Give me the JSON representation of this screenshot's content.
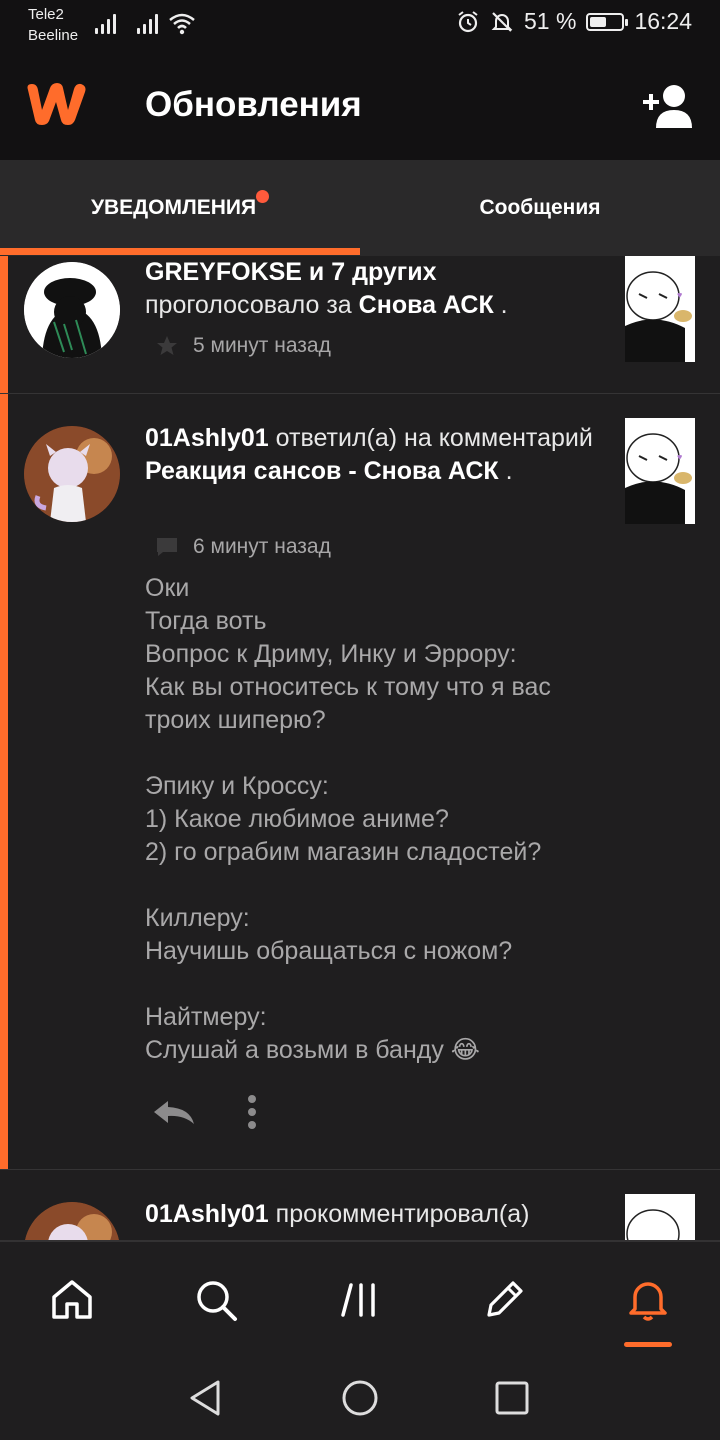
{
  "status_bar": {
    "carrier_1": "Tele2",
    "carrier_2": "Beeline",
    "battery_text": "51 %",
    "battery_level": 0.51,
    "time": "16:24",
    "icons": [
      "signal-icon",
      "signal-icon",
      "wifi-icon",
      "alarm-icon",
      "mute-icon",
      "battery-icon"
    ]
  },
  "header": {
    "title": "Обновления",
    "logo": "wattpad-logo",
    "add_user_icon": "add-user-icon"
  },
  "tabs": [
    {
      "label": "УВЕДОМЛЕНИЯ",
      "active": true,
      "has_dot": true
    },
    {
      "label": "Сообщения",
      "active": false
    }
  ],
  "notifications": [
    {
      "user": "GREYFOKSE и 7 других",
      "action": "проголосовало за",
      "target": "Снова АСК",
      "time": "5 минут назад",
      "meta_icon": "star-icon"
    },
    {
      "user": "01Ashly01",
      "action": "ответил(а) на комментарий",
      "target": "Реакция сансов - Снова АСК",
      "time": "6 минут назад",
      "meta_icon": "comment-icon",
      "comment": "Оки\nТогда воть\n Вопрос к Дриму, Инку и Эррору:\nКак вы относитесь к тому что я вас троих шиперю?\n\nЭпику и Кроссу:\n1) Какое любимое аниме?\n2) го ограбим магазин сладостей?\n\nКиллеру:\nНаучишь обращаться с ножом?\n\nНайтмеру:\nСлушай а возьми в банду 😂"
    },
    {
      "user": "01Ashly01",
      "action": "прокомментировал(а)"
    }
  ],
  "bottom_nav": [
    "home-icon",
    "search-icon",
    "library-icon",
    "write-icon",
    "bell-icon"
  ],
  "accent_color": "#ff6c2b"
}
